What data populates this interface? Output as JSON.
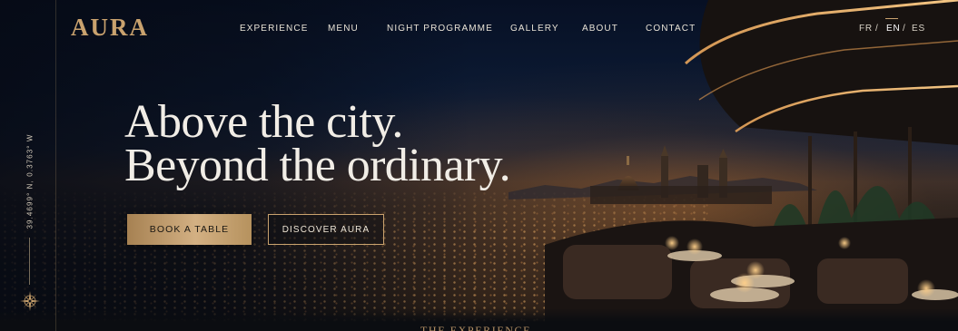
{
  "brand": {
    "name": "AURA"
  },
  "nav": {
    "items": [
      {
        "label": "EXPERIENCE"
      },
      {
        "label": "MENU"
      },
      {
        "label": "NIGHT PROGRAMME"
      },
      {
        "label": "GALLERY"
      },
      {
        "label": "ABOUT"
      },
      {
        "label": "CONTACT"
      }
    ]
  },
  "languages": {
    "options": [
      "FR",
      "EN",
      "ES"
    ],
    "separator": "/",
    "active": "EN"
  },
  "side": {
    "coordinates": "39.4699° N, 0.3763° W"
  },
  "hero": {
    "headline_line1": "Above the city.",
    "headline_line2": "Beyond the ordinary.",
    "primary_cta": "BOOK A TABLE",
    "secondary_cta": "DISCOVER AURA"
  },
  "next_section": {
    "label": "THE EXPERIENCE"
  },
  "colors": {
    "accent_gold": "#c9a26e",
    "background": "#0a0f1a"
  },
  "icons": {
    "compass": "compass-rose-icon"
  }
}
